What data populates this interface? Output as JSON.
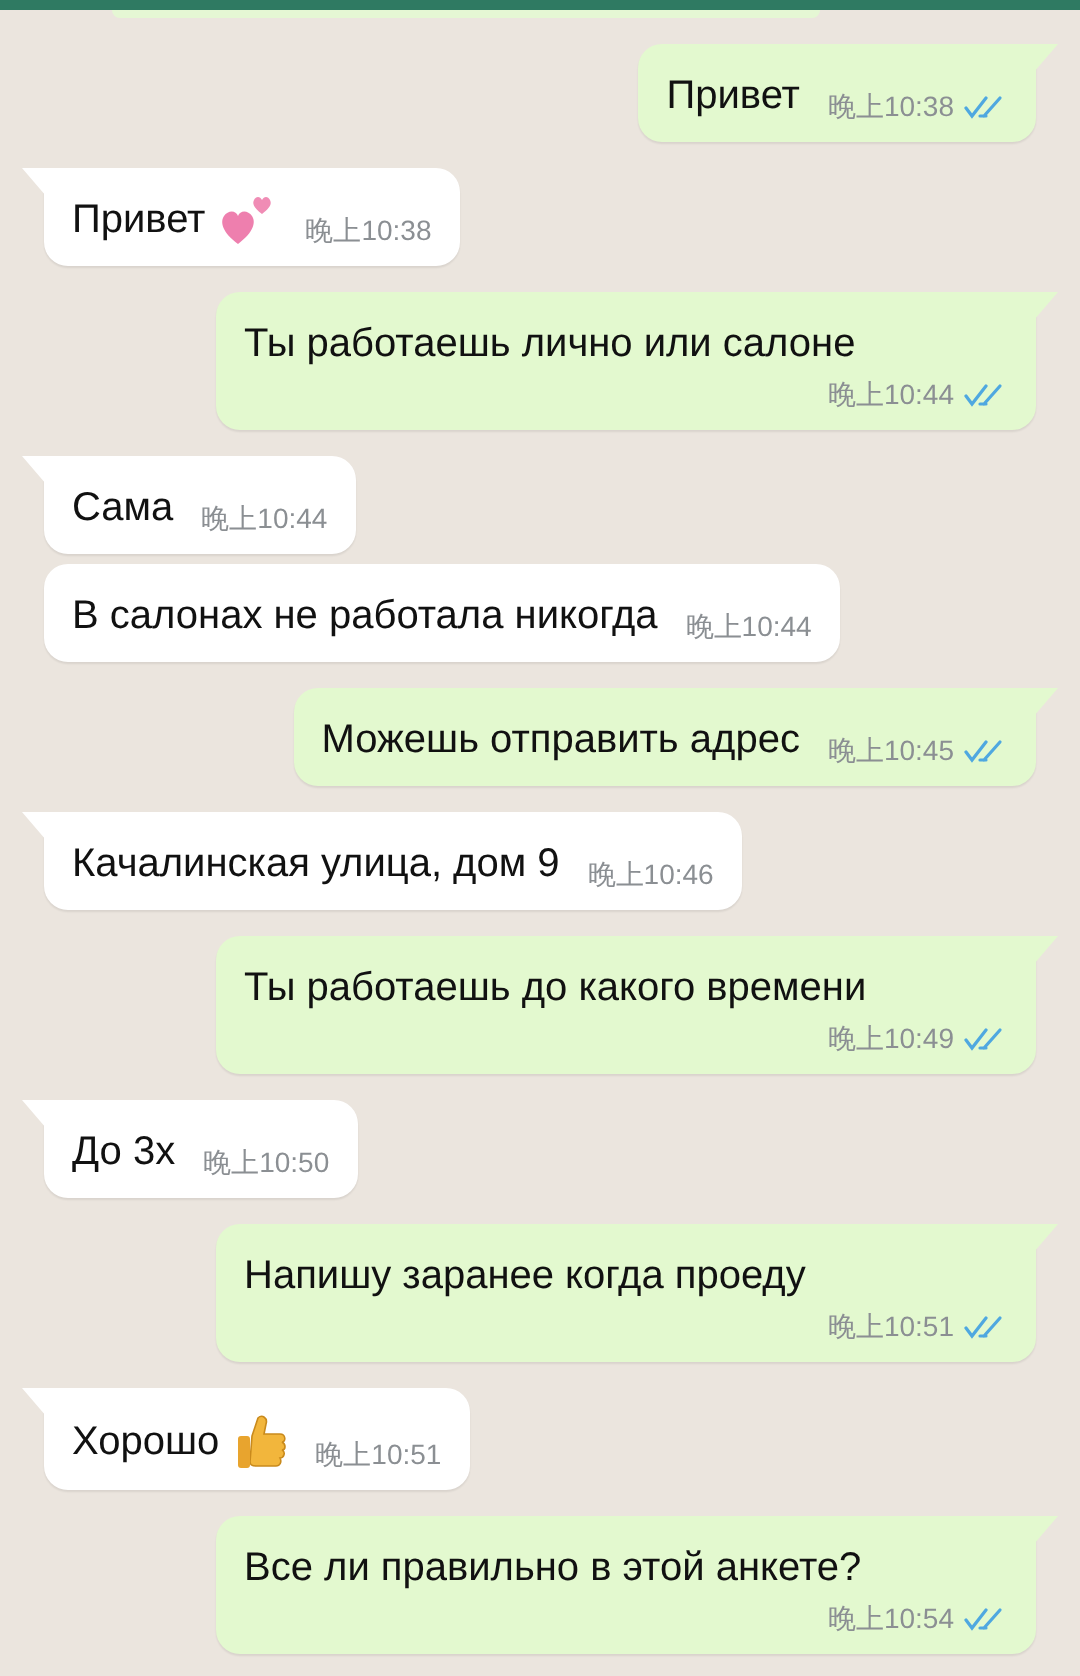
{
  "messages": [
    {
      "kind": "outgoing",
      "text": "Привет",
      "time": "晚上10:38",
      "read": true,
      "tail": true
    },
    {
      "kind": "incoming",
      "text": "Привет",
      "time": "晚上10:38",
      "tail": true
    },
    {
      "kind": "outgoing",
      "text": "Ты работаешь лично или салоне",
      "time": "晚上10:44",
      "read": true,
      "tail": true
    },
    {
      "kind": "incoming",
      "text": "Сама",
      "time": "晚上10:44",
      "tail": true
    },
    {
      "kind": "incoming",
      "text": "В салонах не работала никогда",
      "time": "晚上10:44",
      "tail": false
    },
    {
      "kind": "outgoing",
      "text": "Можешь отправить адрес",
      "time": "晚上10:45",
      "read": true,
      "tail": true
    },
    {
      "kind": "incoming",
      "text": "Качалинская улица, дом 9",
      "time": "晚上10:46",
      "tail": true
    },
    {
      "kind": "outgoing",
      "text": "Ты работаешь до какого времени",
      "time": "晚上10:49",
      "read": true,
      "tail": true
    },
    {
      "kind": "incoming",
      "text": "До 3х",
      "time": "晚上10:50",
      "tail": true
    },
    {
      "kind": "outgoing",
      "text": "Напишу заранее когда проеду",
      "time": "晚上10:51",
      "read": true,
      "tail": true
    },
    {
      "kind": "incoming",
      "text": "Хорошо",
      "time": "晚上10:51",
      "tail": true
    },
    {
      "kind": "outgoing",
      "text": "Все ли правильно в этой анкете?",
      "time": "晚上10:54",
      "read": true,
      "tail": true
    }
  ]
}
